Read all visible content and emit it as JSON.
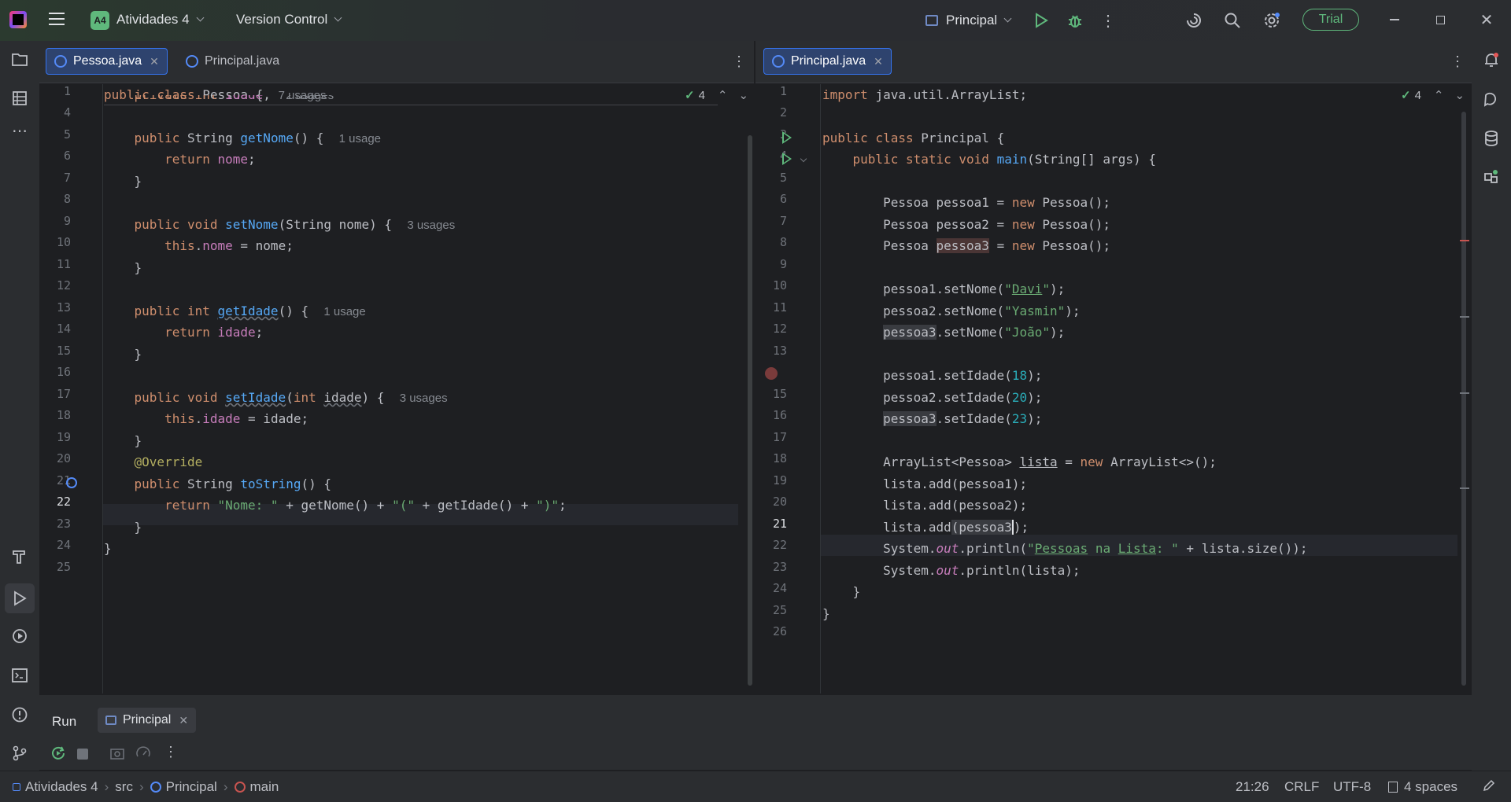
{
  "titlebar": {
    "project_badge": "A4",
    "project_name": "Atividades 4",
    "vcs_label": "Version Control",
    "run_config": "Principal",
    "trial_label": "Trial"
  },
  "left_editor": {
    "tabs": [
      {
        "label": "Pessoa.java",
        "active": true
      },
      {
        "label": "Principal.java",
        "active": false
      }
    ],
    "inspections": "4",
    "lines": [
      {
        "n": "1"
      },
      {
        "n": "4"
      },
      {
        "n": "5"
      },
      {
        "n": "6"
      },
      {
        "n": "7"
      },
      {
        "n": "8"
      },
      {
        "n": "9"
      },
      {
        "n": "10"
      },
      {
        "n": "11"
      },
      {
        "n": "12"
      },
      {
        "n": "13"
      },
      {
        "n": "14"
      },
      {
        "n": "15"
      },
      {
        "n": "16"
      },
      {
        "n": "17"
      },
      {
        "n": "18"
      },
      {
        "n": "19"
      },
      {
        "n": "20"
      },
      {
        "n": "21"
      },
      {
        "n": "22"
      },
      {
        "n": "23"
      },
      {
        "n": "24"
      },
      {
        "n": "25"
      }
    ],
    "hints": {
      "l1": "7 usages",
      "l4": "2 usages",
      "l5": "1 usage",
      "l9": "3 usages",
      "l13": "1 usage",
      "l17": "3 usages"
    }
  },
  "right_editor": {
    "tabs": [
      {
        "label": "Principal.java",
        "active": true
      }
    ],
    "inspections": "4"
  },
  "run_panel": {
    "title": "Run",
    "tab_label": "Principal"
  },
  "statusbar": {
    "breadcrumbs": [
      "Atividades 4",
      "src",
      "Principal",
      "main"
    ],
    "position": "21:26",
    "line_sep": "CRLF",
    "encoding": "UTF-8",
    "indent": "4 spaces"
  }
}
